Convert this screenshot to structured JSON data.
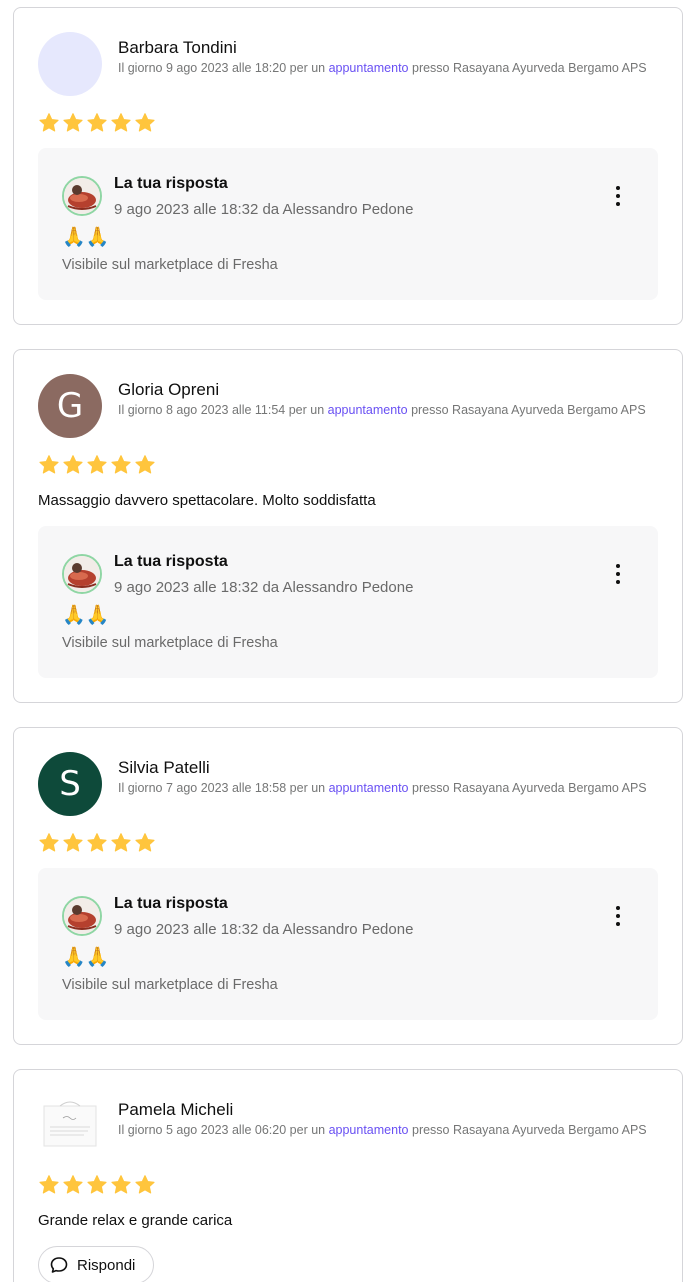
{
  "colors": {
    "star": "#ffc53d",
    "link": "#6950f3",
    "reply_bg": "#f7f7f8",
    "avatar_ring": "#8fd6a4"
  },
  "reviews": [
    {
      "name": "Barbara Tondini",
      "avatar_initial": "",
      "meta_before": "Il giorno 9 ago 2023 alle 18:20 per un ",
      "meta_link": "appuntamento",
      "meta_after": " presso Rasayana Ayurveda Bergamo APS",
      "rating": 5,
      "comment": "",
      "reply": {
        "title": "La tua risposta",
        "date": "9 ago 2023 alle 18:32 da Alessandro Pedone",
        "text": "🙏🙏",
        "visibility": "Visibile sul marketplace di Fresha"
      }
    },
    {
      "name": "Gloria Opreni",
      "avatar_initial": "G",
      "meta_before": "Il giorno 8 ago 2023 alle 11:54 per un ",
      "meta_link": "appuntamento",
      "meta_after": " presso Rasayana Ayurveda Bergamo APS",
      "rating": 5,
      "comment": "Massaggio davvero spettacolare. Molto soddisfatta",
      "reply": {
        "title": "La tua risposta",
        "date": "9 ago 2023 alle 18:32 da Alessandro Pedone",
        "text": "🙏🙏",
        "visibility": "Visibile sul marketplace di Fresha"
      }
    },
    {
      "name": "Silvia Patelli",
      "avatar_initial": "S",
      "meta_before": "Il giorno 7 ago 2023 alle 18:58 per un ",
      "meta_link": "appuntamento",
      "meta_after": " presso Rasayana Ayurveda Bergamo APS",
      "rating": 5,
      "comment": "",
      "reply": {
        "title": "La tua risposta",
        "date": "9 ago 2023 alle 18:32 da Alessandro Pedone",
        "text": "🙏🙏",
        "visibility": "Visibile sul marketplace di Fresha"
      }
    },
    {
      "name": "Pamela Micheli",
      "avatar_initial": "",
      "meta_before": "Il giorno 5 ago 2023 alle 06:20 per un ",
      "meta_link": "appuntamento",
      "meta_after": " presso Rasayana Ayurveda Bergamo APS",
      "rating": 5,
      "comment": "Grande relax e grande carica",
      "reply_button_label": "Rispondi"
    }
  ]
}
